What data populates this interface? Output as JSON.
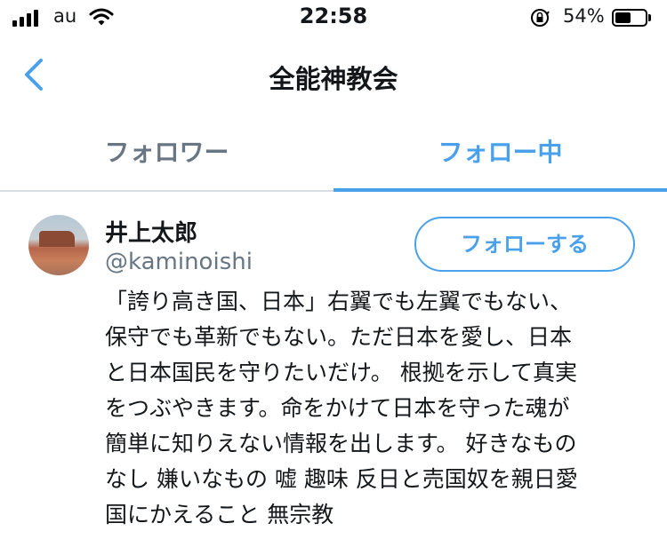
{
  "status_bar": {
    "carrier": "au",
    "time": "22:58",
    "battery_percent": "54%",
    "battery_level": 0.54,
    "icons": [
      "signal-icon",
      "wifi-icon",
      "orientation-lock-icon",
      "battery-icon"
    ]
  },
  "nav": {
    "title": "全能神教会",
    "back_icon": "chevron-left-icon"
  },
  "tabs": [
    {
      "label": "フォロワー",
      "active": false
    },
    {
      "label": "フォロー中",
      "active": true
    }
  ],
  "user": {
    "name": "井上太郎",
    "handle": "@kaminoishi",
    "follow_label": "フォローする",
    "bio": "「誇り高き国、日本」右翼でも左翼でもない、\n保守でも革新でもない。ただ日本を愛し、日本\nと日本国民を守りたいだけ。 根拠を示して真実\nをつぶやきます。命をかけて日本を守った魂が\n簡単に知りえない情報を出します。 好きなもの\nなし 嫌いなもの 嘘 趣味 反日と売国奴を親日愛\n国にかえること 無宗教"
  },
  "colors": {
    "accent": "#4aa1eb",
    "secondary_text": "#687684",
    "primary_text": "#14171a",
    "divider": "#d8dde2"
  }
}
